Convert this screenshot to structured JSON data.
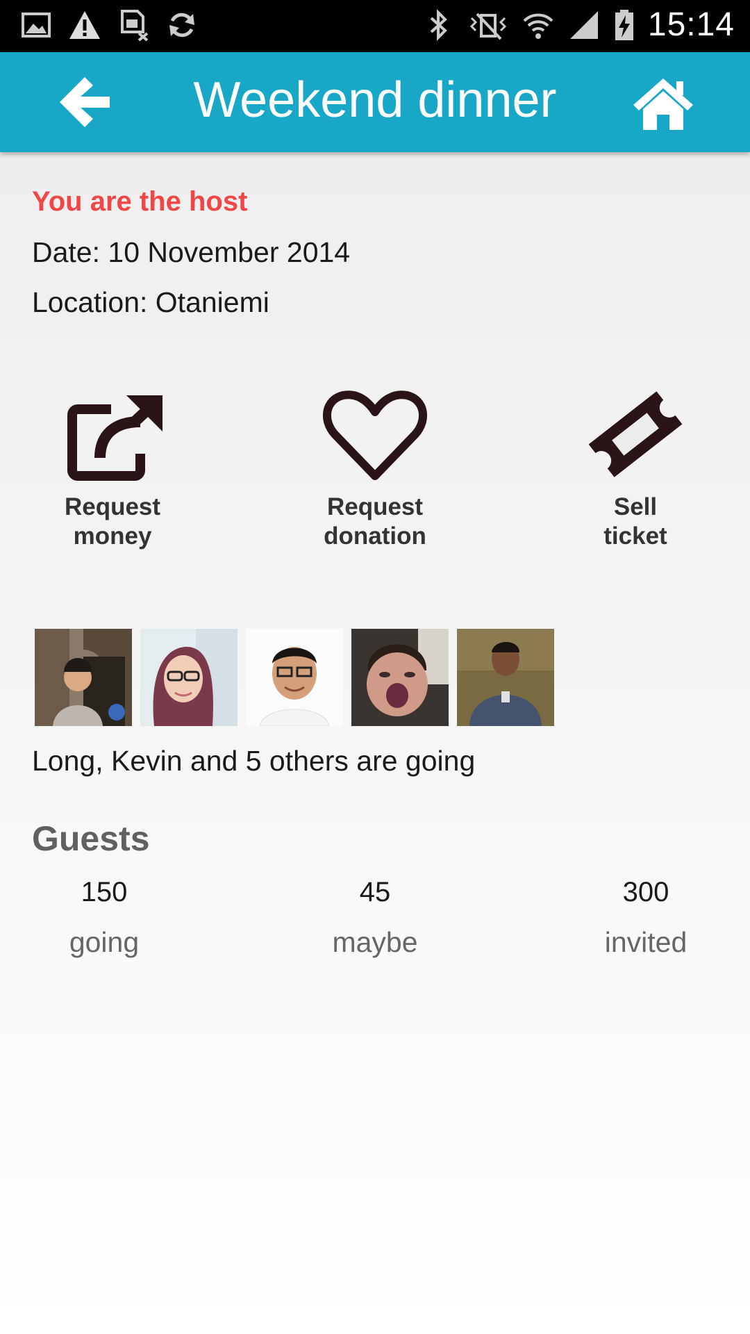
{
  "status_bar": {
    "time": "15:14",
    "left_icons": [
      "gallery-icon",
      "warning-icon",
      "sim-off-icon",
      "sync-icon"
    ],
    "right_icons": [
      "bluetooth-icon",
      "vibrate-icon",
      "wifi-icon",
      "signal-icon",
      "battery-charging-icon"
    ]
  },
  "app_bar": {
    "title": "Weekend dinner",
    "back_icon": "back-arrow-icon",
    "home_icon": "home-icon",
    "background": "#18a7c6"
  },
  "event": {
    "host_label": "You are the host",
    "date": "Date: 10 November 2014",
    "location": "Location: Otaniemi"
  },
  "actions": [
    {
      "label": "Request\nmoney",
      "icon": "external-link-icon"
    },
    {
      "label": "Request\ndonation",
      "icon": "heart-icon"
    },
    {
      "label": "Sell\nticket",
      "icon": "ticket-icon"
    }
  ],
  "attendees": {
    "avatar_count": 5,
    "summary": "Long, Kevin and 5 others are going"
  },
  "guests": {
    "title": "Guests",
    "stats": [
      {
        "value": "150",
        "label": "going"
      },
      {
        "value": "45",
        "label": "maybe"
      },
      {
        "value": "300",
        "label": "invited"
      }
    ]
  },
  "colors": {
    "host_text": "#f04646",
    "icon_color": "#2a1416"
  }
}
